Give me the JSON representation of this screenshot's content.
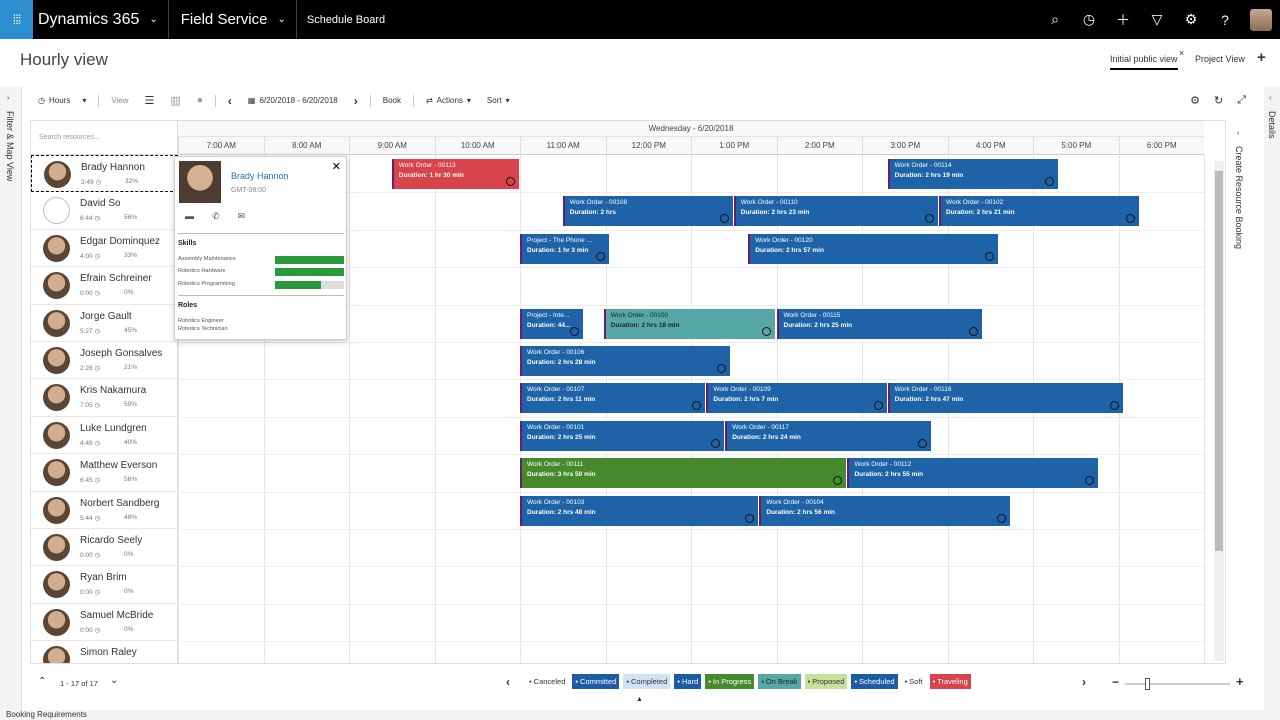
{
  "topbar": {
    "app_name": "Dynamics 365",
    "module": "Field Service",
    "page": "Schedule Board"
  },
  "header": {
    "title": "Hourly view",
    "tabs": [
      {
        "label": "Initial public view",
        "active": true
      },
      {
        "label": "Project View",
        "active": false
      }
    ]
  },
  "rails": {
    "left": "Filter & Map View",
    "right_details": "Details",
    "right_create": "Create Resource Booking"
  },
  "toolbar": {
    "hours": "Hours",
    "view": "View",
    "date_range": "6/20/2018 - 6/20/2018",
    "book": "Book",
    "actions": "Actions",
    "sort": "Sort"
  },
  "board": {
    "search_placeholder": "Search resources...",
    "date_header": "Wednesday - 6/20/2018",
    "hours": [
      "7:00 AM",
      "8:00 AM",
      "9:00 AM",
      "10:00 AM",
      "11:00 AM",
      "12:00 PM",
      "1:00 PM",
      "2:00 PM",
      "3:00 PM",
      "4:00 PM",
      "5:00 PM",
      "6:00 PM"
    ]
  },
  "resources": [
    {
      "name": "Brady Hannon",
      "time": "3:49",
      "pct": "32%",
      "selected": true
    },
    {
      "name": "David So",
      "time": "6:44",
      "pct": "56%"
    },
    {
      "name": "Edgar Dominquez",
      "time": "4:00",
      "pct": "33%"
    },
    {
      "name": "Efrain Schreiner",
      "time": "0:00",
      "pct": "0%"
    },
    {
      "name": "Jorge Gault",
      "time": "5:27",
      "pct": "45%"
    },
    {
      "name": "Joseph Gonsalves",
      "time": "2:28",
      "pct": "21%"
    },
    {
      "name": "Kris Nakamura",
      "time": "7:05",
      "pct": "59%"
    },
    {
      "name": "Luke Lundgren",
      "time": "4:49",
      "pct": "40%"
    },
    {
      "name": "Matthew Everson",
      "time": "6:45",
      "pct": "56%"
    },
    {
      "name": "Norbert Sandberg",
      "time": "5:44",
      "pct": "48%"
    },
    {
      "name": "Ricardo Seely",
      "time": "0:00",
      "pct": "0%"
    },
    {
      "name": "Ryan Brim",
      "time": "0:00",
      "pct": "0%"
    },
    {
      "name": "Samuel McBride",
      "time": "0:00",
      "pct": "0%"
    },
    {
      "name": "Simon Raley",
      "time": "",
      "pct": ""
    }
  ],
  "bookings": [
    {
      "row": 0,
      "start": 9.5,
      "end": 11.0,
      "title": "Work Order - 00113",
      "duration": "1 hr 30 min",
      "status": "Traveling"
    },
    {
      "row": 0,
      "start": 15.3,
      "end": 17.3,
      "title": "Work Order - 00114",
      "duration": "2 hrs 19 min",
      "status": "Scheduled"
    },
    {
      "row": 1,
      "start": 11.5,
      "end": 13.5,
      "title": "Work Order - 00108",
      "duration": "2 hrs",
      "status": "Scheduled"
    },
    {
      "row": 1,
      "start": 13.5,
      "end": 15.9,
      "title": "Work Order - 00110",
      "duration": "2 hrs 23 min",
      "status": "Scheduled"
    },
    {
      "row": 1,
      "start": 15.9,
      "end": 18.25,
      "title": "Work Order - 00102",
      "duration": "2 hrs 21 min",
      "status": "Scheduled"
    },
    {
      "row": 2,
      "start": 11.0,
      "end": 12.05,
      "title": "Project - The Phone ...",
      "duration": "1 hr 3 min",
      "status": "Hard"
    },
    {
      "row": 2,
      "start": 13.67,
      "end": 16.6,
      "title": "Work Order - 00120",
      "duration": "2 hrs 57 min",
      "status": "Scheduled"
    },
    {
      "row": 4,
      "start": 11.0,
      "end": 11.75,
      "title": "Project - Inte...",
      "duration": "44...",
      "status": "Hard"
    },
    {
      "row": 4,
      "start": 11.98,
      "end": 14.0,
      "title": "Work Order - 00100",
      "duration": "2 hrs 18 min",
      "status": "On Break"
    },
    {
      "row": 4,
      "start": 14.0,
      "end": 16.42,
      "title": "Work Order - 00115",
      "duration": "2 hrs 25 min",
      "status": "Scheduled"
    },
    {
      "row": 5,
      "start": 11.0,
      "end": 13.47,
      "title": "Work Order - 00106",
      "duration": "2 hrs 28 min",
      "status": "Scheduled"
    },
    {
      "row": 6,
      "start": 11.0,
      "end": 13.18,
      "title": "Work Order - 00107",
      "duration": "2 hrs 11 min",
      "status": "Scheduled"
    },
    {
      "row": 6,
      "start": 13.18,
      "end": 15.3,
      "title": "Work Order - 00109",
      "duration": "2 hrs 7 min",
      "status": "Scheduled"
    },
    {
      "row": 6,
      "start": 15.3,
      "end": 18.07,
      "title": "Work Order - 00116",
      "duration": "2 hrs 47 min",
      "status": "Scheduled"
    },
    {
      "row": 7,
      "start": 11.0,
      "end": 13.4,
      "title": "Work Order - 00101",
      "duration": "2 hrs 25 min",
      "status": "Scheduled"
    },
    {
      "row": 7,
      "start": 13.4,
      "end": 15.82,
      "title": "Work Order - 00117",
      "duration": "2 hrs 24 min",
      "status": "Scheduled"
    },
    {
      "row": 8,
      "start": 11.0,
      "end": 14.83,
      "title": "Work Order - 00111",
      "duration": "3 hrs 50 min",
      "status": "In Progress"
    },
    {
      "row": 8,
      "start": 14.83,
      "end": 17.77,
      "title": "Work Order - 00112",
      "duration": "2 hrs 55 min",
      "status": "Scheduled"
    },
    {
      "row": 9,
      "start": 11.0,
      "end": 13.8,
      "title": "Work Order - 00103",
      "duration": "2 hrs 48 min",
      "status": "Scheduled"
    },
    {
      "row": 9,
      "start": 13.8,
      "end": 16.74,
      "title": "Work Order - 00104",
      "duration": "2 hrs 56 min",
      "status": "Scheduled"
    }
  ],
  "popup": {
    "name": "Brady Hannon",
    "timezone": "GMT-08:00",
    "skills_title": "Skills",
    "skills": [
      {
        "name": "Assembly Maintenance",
        "level": 1.0
      },
      {
        "name": "Robotics Hardware",
        "level": 1.0
      },
      {
        "name": "Robotics Programming",
        "level": 0.67
      }
    ],
    "roles_title": "Roles",
    "roles": [
      "Robotics Engineer",
      "Robotics Technician"
    ]
  },
  "footer": {
    "paging": "1 - 17 of 17",
    "legend": [
      {
        "label": "Canceled",
        "color": "#ffffff",
        "text": "#333333"
      },
      {
        "label": "Committed",
        "color": "#1e5ba6",
        "text": "#ffffff"
      },
      {
        "label": "Completed",
        "color": "#cfe3f7",
        "text": "#333333"
      },
      {
        "label": "Hard",
        "color": "#1e5ba6",
        "text": "#ffffff"
      },
      {
        "label": "In Progress",
        "color": "#468a2d",
        "text": "#ffffff"
      },
      {
        "label": "On Break",
        "color": "#56a8a8",
        "text": "#222222"
      },
      {
        "label": "Proposed",
        "color": "#c6e29a",
        "text": "#333333"
      },
      {
        "label": "Scheduled",
        "color": "#1e5ba6",
        "text": "#ffffff"
      },
      {
        "label": "Soft",
        "color": "#ffffff",
        "text": "#333333"
      },
      {
        "label": "Traveling",
        "color": "#d9434b",
        "text": "#ffffff"
      }
    ],
    "booking_requirements": "Booking Requirements"
  },
  "colors": {
    "Scheduled": "#1e63a8",
    "Hard": "#1e63a8",
    "Traveling": "#d9434b",
    "On Break": "#56a8a8",
    "In Progress": "#468a2d"
  }
}
